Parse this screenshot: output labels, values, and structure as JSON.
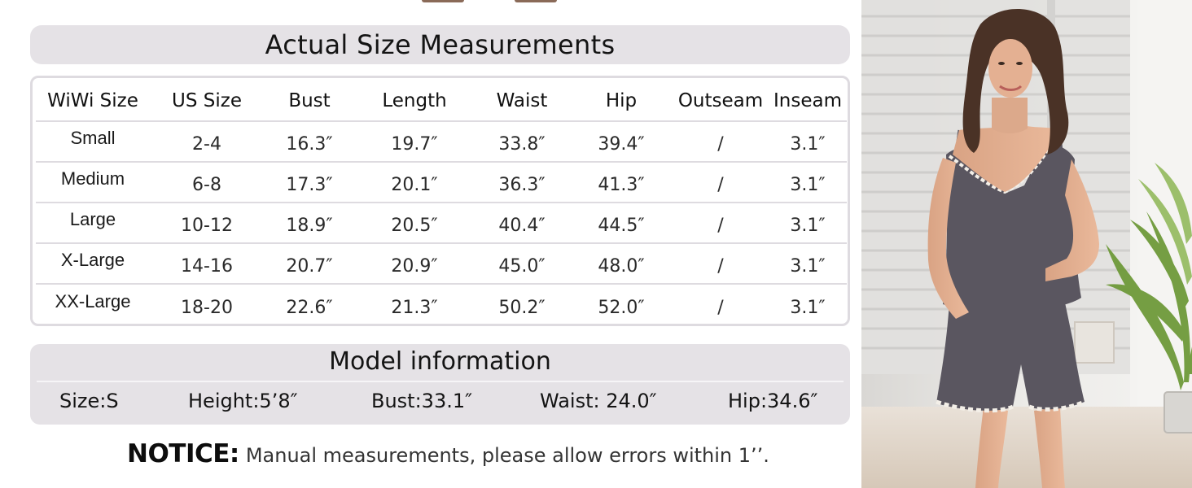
{
  "title": "Actual Size Measurements",
  "size_table": {
    "headers": [
      "WiWi Size",
      "US Size",
      "Bust",
      "Length",
      "Waist",
      "Hip",
      "Outseam",
      "Inseam"
    ],
    "rows": [
      [
        "Small",
        "2-4",
        "16.3″",
        "19.7″",
        "33.8″",
        "39.4″",
        "/",
        "3.1″"
      ],
      [
        "Medium",
        "6-8",
        "17.3″",
        "20.1″",
        "36.3″",
        "41.3″",
        "/",
        "3.1″"
      ],
      [
        "Large",
        "10-12",
        "18.9″",
        "20.5″",
        "40.4″",
        "44.5″",
        "/",
        "3.1″"
      ],
      [
        "X-Large",
        "14-16",
        "20.7″",
        "20.9″",
        "45.0″",
        "48.0″",
        "/",
        "3.1″"
      ],
      [
        "XX-Large",
        "18-20",
        "22.6″",
        "21.3″",
        "50.2″",
        "52.0″",
        "/",
        "3.1″"
      ]
    ]
  },
  "model": {
    "title": "Model information",
    "size": "Size:S",
    "height": "Height:5’8″",
    "bust": "Bust:33.1″",
    "waist": "Waist: 24.0″",
    "hip": "Hip:34.6″"
  },
  "notice": {
    "label": "NOTICE:",
    "text": "Manual measurements, please allow errors within 1’’."
  },
  "colors": {
    "panel_bg": "#e5e2e6",
    "garment": "#5a5660",
    "trim": "#f3efe8"
  }
}
